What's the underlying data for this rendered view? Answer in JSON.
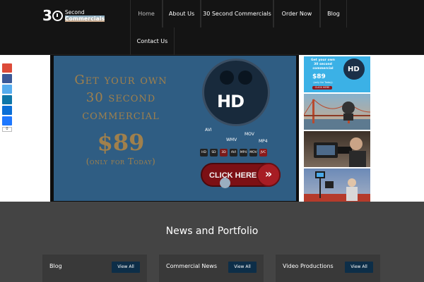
{
  "header": {
    "logo": {
      "number": "30",
      "line1": "Second",
      "line2": "Commercials"
    },
    "nav": [
      {
        "label": "Home",
        "active": true
      },
      {
        "label": "About Us",
        "active": false
      },
      {
        "label": "30 Second Commercials",
        "active": false
      },
      {
        "label": "Order Now",
        "active": false
      },
      {
        "label": "Blog",
        "active": false
      },
      {
        "label": "Contact Us",
        "active": false
      }
    ]
  },
  "share_bar": {
    "buttons": [
      {
        "name": "google-plus",
        "color": "#dd4b39"
      },
      {
        "name": "facebook",
        "color": "#3b5998"
      },
      {
        "name": "twitter",
        "color": "#55acee"
      },
      {
        "name": "linkedin",
        "color": "#0e76a8"
      },
      {
        "name": "stumbleupon",
        "color": "#0a6ed6"
      },
      {
        "name": "share",
        "color": "#1e78ff"
      }
    ],
    "count": "0"
  },
  "slider": {
    "headline_line1": "Get your own",
    "headline_line2": "30 second",
    "headline_line3": "commercial",
    "price": "$89",
    "subtext": "(only for Today)",
    "hd_label": "HD",
    "formats": [
      "AVI",
      "WMV",
      "MOV",
      "MP4"
    ],
    "format_icons": [
      "HD",
      "SD",
      "3D",
      "AVI",
      "MP4",
      "MOV",
      "JVC"
    ],
    "cta_label": "CLICK HERE",
    "cta_arrow": "»",
    "bg_color": "#2f5d83",
    "text_color": "#a0804c"
  },
  "thumbnails": [
    {
      "name": "thumb-commercial-ad",
      "text_line1": "Get your own",
      "text_line2": "30 second",
      "text_line3": "commercial",
      "price": "$89",
      "subtext": "(only for Today)",
      "button": "CLICK HERE",
      "hd": "HD"
    },
    {
      "name": "thumb-golden-gate"
    },
    {
      "name": "thumb-camera-operator"
    },
    {
      "name": "thumb-studio-set"
    }
  ],
  "news": {
    "title": "News and Portfolio",
    "cards": [
      {
        "label": "Blog",
        "button": "View All"
      },
      {
        "label": "Commercial News",
        "button": "View All"
      },
      {
        "label": "Video Productions",
        "button": "View All"
      }
    ]
  }
}
